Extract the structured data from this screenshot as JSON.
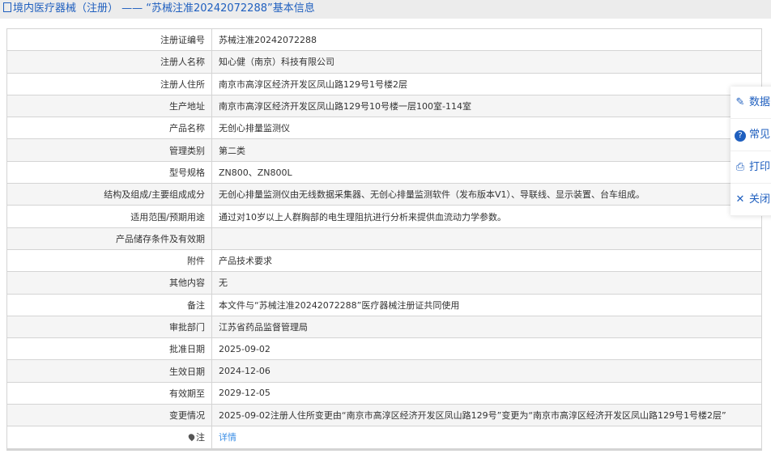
{
  "header": {
    "title": "境内医疗器械（注册）  ——  “苏械注准20242072288”基本信息"
  },
  "rows": [
    {
      "label": "注册证编号",
      "value": "苏械注准20242072288"
    },
    {
      "label": "注册人名称",
      "value": "知心健（南京）科技有限公司"
    },
    {
      "label": "注册人住所",
      "value": "南京市高淳区经济开发区凤山路129号1号楼2层"
    },
    {
      "label": "生产地址",
      "value": "南京市高淳区经济开发区凤山路129号10号楼一层100室-114室"
    },
    {
      "label": "产品名称",
      "value": "无创心排量监测仪"
    },
    {
      "label": "管理类别",
      "value": "第二类"
    },
    {
      "label": "型号规格",
      "value": "ZN800、ZN800L"
    },
    {
      "label": "结构及组成/主要组成成分",
      "value": "无创心排量监测仪由无线数据采集器、无创心排量监测软件（发布版本V1）、导联线、显示装置、台车组成。"
    },
    {
      "label": "适用范围/预期用途",
      "value": "通过对10岁以上人群胸部的电生理阻抗进行分析来提供血流动力学参数。"
    },
    {
      "label": "产品储存条件及有效期",
      "value": ""
    },
    {
      "label": "附件",
      "value": "产品技术要求"
    },
    {
      "label": "其他内容",
      "value": "无"
    },
    {
      "label": "备注",
      "value": "本文件与“苏械注准20242072288”医疗器械注册证共同使用"
    },
    {
      "label": "审批部门",
      "value": "江苏省药品监督管理局"
    },
    {
      "label": "批准日期",
      "value": "2025-09-02"
    },
    {
      "label": "生效日期",
      "value": "2024-12-06"
    },
    {
      "label": "有效期至",
      "value": "2029-12-05"
    },
    {
      "label": "变更情况",
      "value": "2025-09-02注册人住所变更由“南京市高淳区经济开发区凤山路129号”变更为“南京市高淳区经济开发区凤山路129号1号楼2层”"
    }
  ],
  "note": {
    "label": "注",
    "link": "详情"
  },
  "float_menu": {
    "data": "数据",
    "faq": "常见",
    "print": "打印",
    "close": "关闭"
  }
}
